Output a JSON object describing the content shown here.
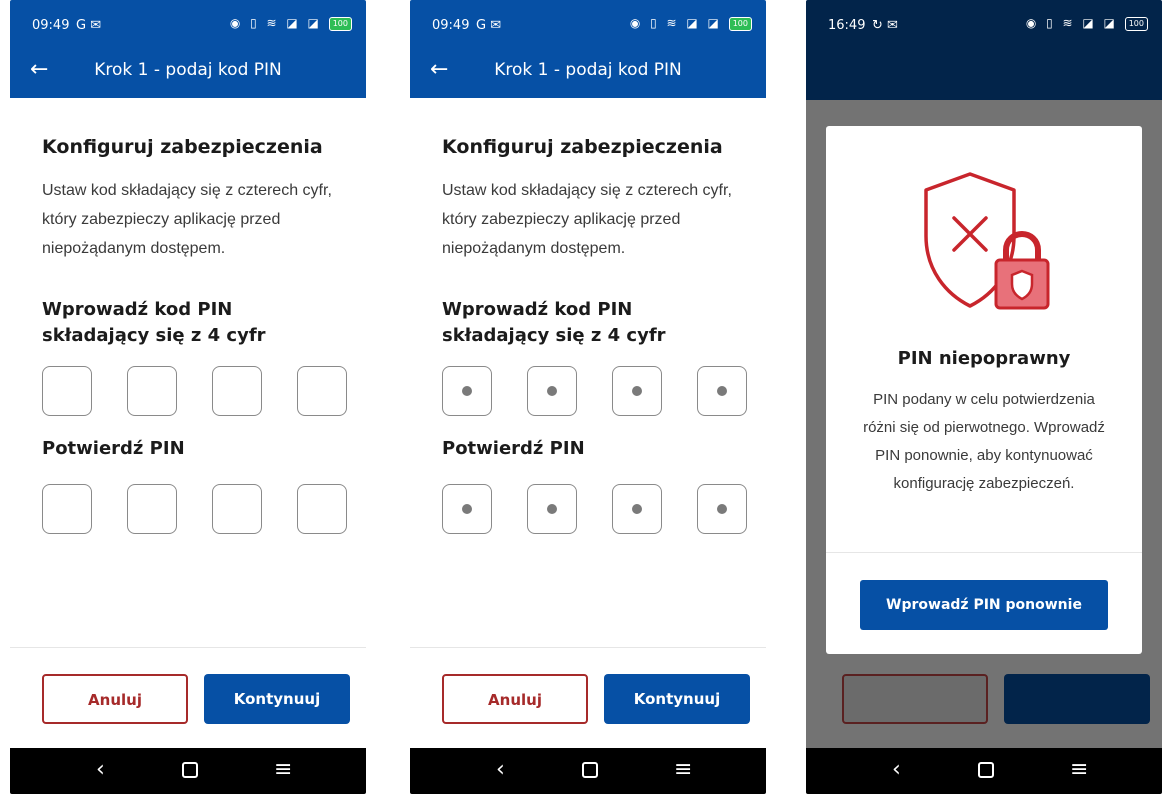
{
  "screens": [
    {
      "status": {
        "time": "09:49",
        "icons": "G ✉",
        "right_icons": "◉ ▯ ≋ ◪ ◪",
        "battery": "100"
      },
      "appbar": {
        "back_icon": "arrow-left",
        "title": "Krok 1 - podaj kod PIN"
      },
      "heading": "Konfiguruj zabezpieczenia",
      "description": "Ustaw kod składający się z czterech cyfr, który zabezpieczy aplikację przed niepożądanym dostępem.",
      "pin_label": "Wprowadź kod PIN składający się z 4 cyfr",
      "confirm_label": "Potwierdź PIN",
      "pin_filled": [
        false,
        false,
        false,
        false
      ],
      "confirm_filled": [
        false,
        false,
        false,
        false
      ],
      "cancel_label": "Anuluj",
      "continue_label": "Kontynuuj"
    },
    {
      "status": {
        "time": "09:49",
        "icons": "G ✉",
        "right_icons": "◉ ▯ ≋ ◪ ◪",
        "battery": "100"
      },
      "appbar": {
        "back_icon": "arrow-left",
        "title": "Krok 1 - podaj kod PIN"
      },
      "heading": "Konfiguruj zabezpieczenia",
      "description": "Ustaw kod składający się z czterech cyfr, który zabezpieczy aplikację przed niepożądanym dostępem.",
      "pin_label": "Wprowadź kod PIN składający się z 4 cyfr",
      "confirm_label": "Potwierdź PIN",
      "pin_filled": [
        true,
        true,
        true,
        true
      ],
      "confirm_filled": [
        true,
        true,
        true,
        true
      ],
      "cancel_label": "Anuluj",
      "continue_label": "Kontynuuj"
    },
    {
      "status": {
        "time": "16:49",
        "icons": "↻ ✉",
        "right_icons": "◉ ▯ ≋ ◪ ◪",
        "battery": "100"
      },
      "dialog": {
        "icon": "shield-lock-error-icon",
        "title": "PIN niepoprawny",
        "message": "PIN podany w celu potwierdzenia różni się od pierwotnego. Wprowadź PIN ponownie, aby kontynuować konfigurację zabezpieczeń.",
        "button_label": "Wprowadź PIN ponownie"
      }
    }
  ],
  "nav": {
    "back": "‹",
    "home": "home-icon",
    "menu": "≡"
  },
  "colors": {
    "primary": "#0650a5",
    "danger": "#a62a2a",
    "illustration": "#c8252c"
  }
}
